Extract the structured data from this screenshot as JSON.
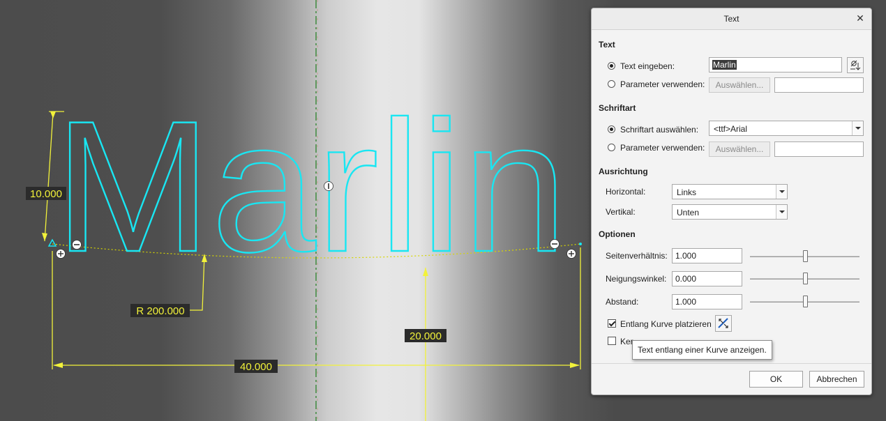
{
  "canvas": {
    "sketch_text": "Marlin",
    "dimensions": {
      "height": "10.000",
      "radius": "R 200.000",
      "center_offset": "20.000",
      "width": "40.000"
    },
    "colors": {
      "sketch": "#19e6f2",
      "dimension": "#f2f23a",
      "centerline": "#3e8a3e"
    }
  },
  "dialog": {
    "title": "Text",
    "close_icon": "close-icon",
    "text_section": {
      "title": "Text",
      "option_enter_label": "Text eingeben:",
      "text_value": "Marlin",
      "option_param_label": "Parameter verwenden:",
      "select_button": "Auswählen...",
      "symbol_icon": "symbol-palette-icon"
    },
    "font_section": {
      "title": "Schriftart",
      "option_select_label": "Schriftart auswählen:",
      "font_value": "<ttf>Arial",
      "option_param_label": "Parameter verwenden:",
      "select_button": "Auswählen..."
    },
    "alignment_section": {
      "title": "Ausrichtung",
      "horizontal_label": "Horizontal:",
      "horizontal_value": "Links",
      "vertical_label": "Vertikal:",
      "vertical_value": "Unten"
    },
    "options_section": {
      "title": "Optionen",
      "aspect_label": "Seitenverhältnis:",
      "aspect_value": "1.000",
      "slant_label": "Neigungswinkel:",
      "slant_value": "0.000",
      "spacing_label": "Abstand:",
      "spacing_value": "1.000",
      "along_curve_label": "Entlang Kurve platzieren",
      "along_curve_checked": true,
      "kerning_label": "Ker",
      "kerning_checked": false,
      "flip_icon": "flip-curve-direction-icon"
    },
    "ok_button": "OK",
    "cancel_button": "Abbrechen"
  },
  "tooltip": {
    "text": "Text entlang einer Kurve anzeigen."
  }
}
